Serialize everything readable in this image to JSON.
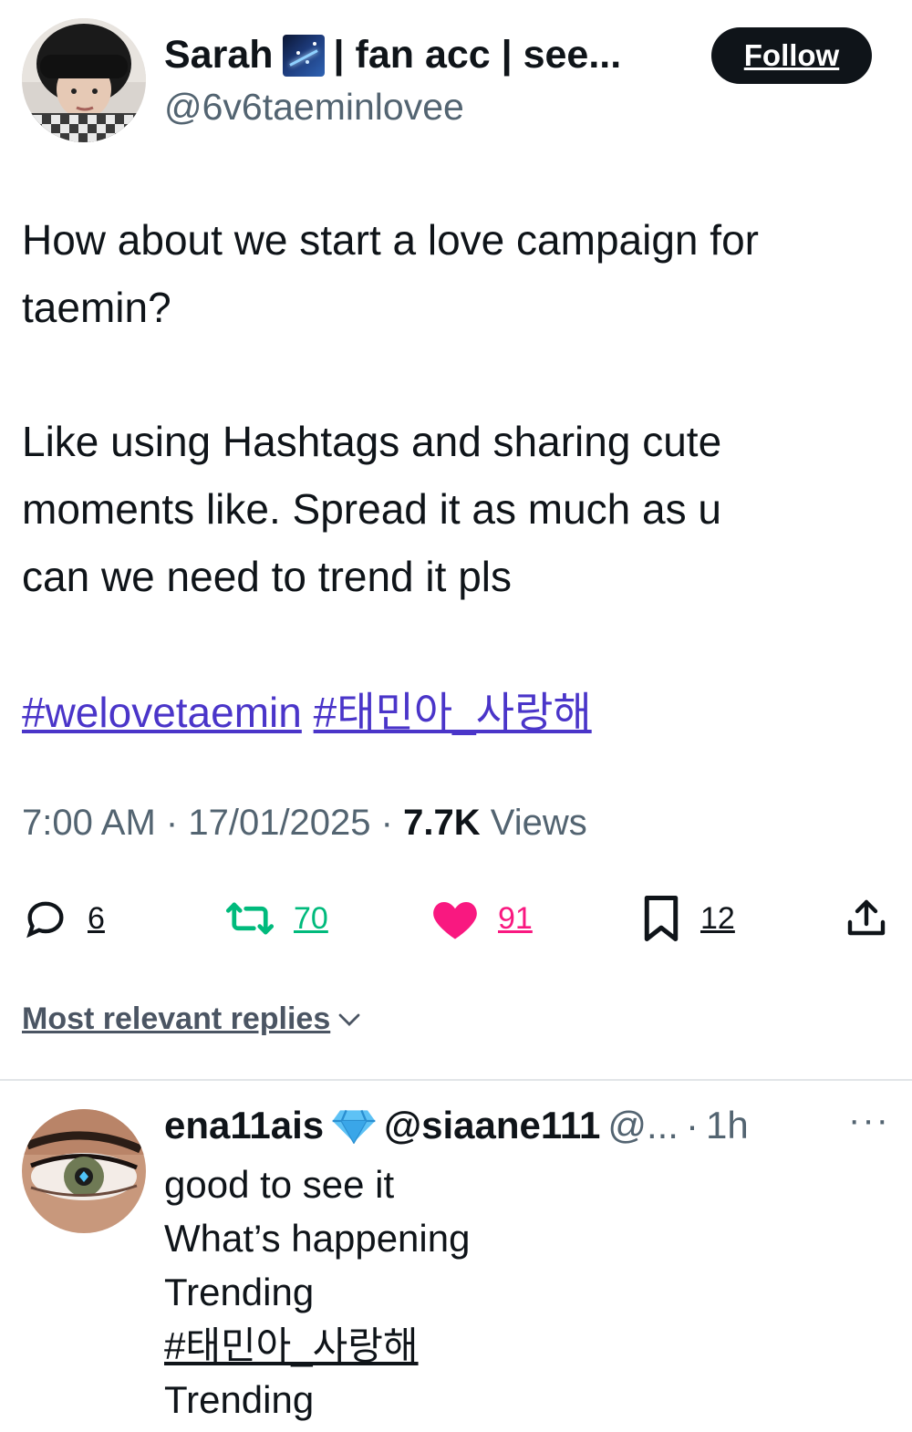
{
  "post": {
    "author_name": "Sarah",
    "author_name_suffix": "| fan acc | see...",
    "handle": "@6v6taeminlovee",
    "follow_label": "Follow",
    "body_line1": "How about we start a love campaign for",
    "body_line2": "taemin?",
    "body_line3": "Like using Hashtags and sharing cute",
    "body_line4": "moments like. Spread it as much as u",
    "body_line5": "can we need to trend it pls",
    "hashtags": [
      "#welovetaemin",
      "#태민아_사랑해"
    ],
    "time": "7:00 AM",
    "date": "17/01/2025",
    "views_count": "7.7K",
    "views_label": "Views",
    "separator": "·",
    "stats": {
      "replies": "6",
      "reposts": "70",
      "likes": "91",
      "bookmarks": "12"
    },
    "colors": {
      "repost": "#00ba7c",
      "like": "#f91880",
      "hashtag": "#4a35c9",
      "follow_bg": "#0f1419"
    }
  },
  "replies_sort_label": "Most relevant replies",
  "reply": {
    "name": "ena11ais",
    "badge_icon": "diamond-icon",
    "handle": "@siaane111",
    "handle2": "@...",
    "separator": "·",
    "time": "1h",
    "more": "···",
    "line1": "good to see it",
    "line2": "What’s happening",
    "line3": "Trending",
    "line4": "#태민아_사랑해",
    "line5": "Trending"
  }
}
